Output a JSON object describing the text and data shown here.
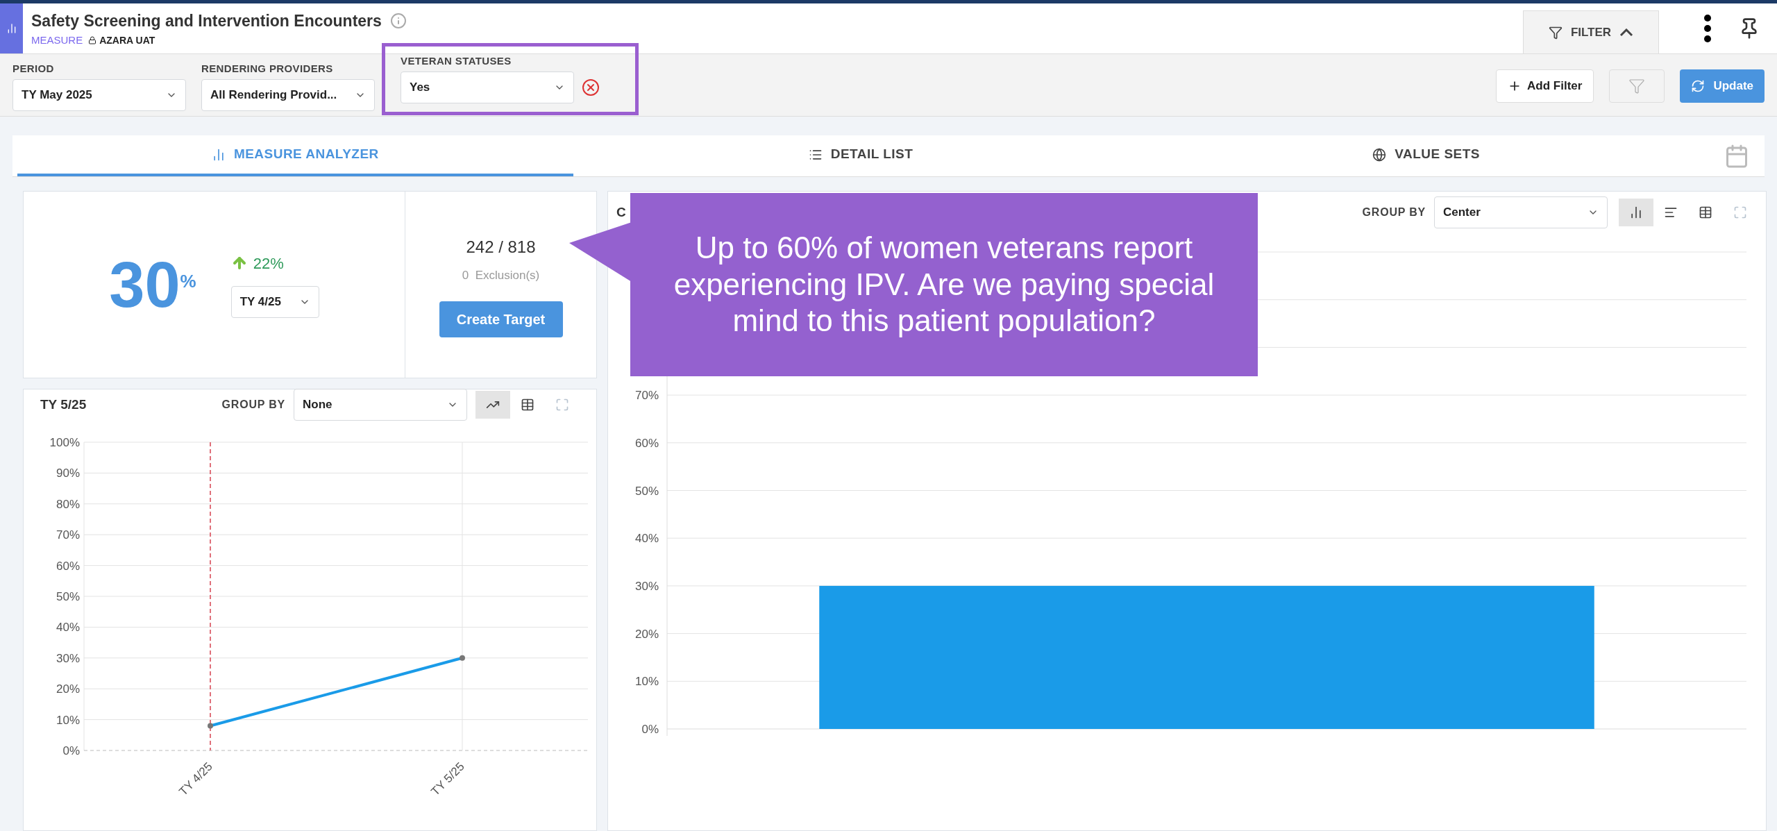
{
  "header": {
    "title": "Safety Screening and Intervention Encounters",
    "type_label": "MEASURE",
    "workspace": "AZARA UAT",
    "filter_toggle": {
      "label": "FILTER",
      "expanded": true
    }
  },
  "filters": [
    {
      "label": "PERIOD",
      "value": "TY May 2025",
      "highlighted": false
    },
    {
      "label": "RENDERING PROVIDERS",
      "value": "All Rendering Provid...",
      "highlighted": false
    },
    {
      "label": "VETERAN STATUSES",
      "value": "Yes",
      "removable": true,
      "highlighted": true
    }
  ],
  "filter_actions": {
    "add_label": "Add Filter",
    "update_label": "Update"
  },
  "tabs": [
    {
      "kind": "analyzer",
      "label": "MEASURE ANALYZER",
      "selected": true
    },
    {
      "kind": "list",
      "label": "DETAIL LIST",
      "selected": false
    },
    {
      "kind": "sets",
      "label": "VALUE SETS",
      "selected": false
    }
  ],
  "summary": {
    "rate": "30",
    "rate_unit": "%",
    "change": "22%",
    "increase": true,
    "compare_period": "TY 4/25",
    "ratio": "242 / 818",
    "exclusions": "0  Exclusion(s)",
    "target_button": "Create Target"
  },
  "trend": {
    "title": "TY 5/25",
    "group_by_label": "GROUP BY",
    "group_by": "None",
    "views": [
      {
        "kind": "line",
        "selected": true
      },
      {
        "kind": "table",
        "selected": false
      },
      {
        "kind": "expand",
        "selected": false
      }
    ],
    "chart_data": {
      "type": "line",
      "grid": true,
      "categories": [
        "TY 4/25",
        "TY 5/25"
      ],
      "series": [
        {
          "color": "#1a9be8",
          "marker": true,
          "values": [
            8,
            30
          ]
        }
      ],
      "ref_lines": [
        {
          "axis": "x",
          "value": "TY 4/25",
          "color": "#e0707a"
        }
      ],
      "ylim": [
        0,
        100
      ],
      "yticks": [
        {
          "value": 0,
          "label": "0%"
        },
        {
          "value": 10,
          "label": "10%"
        },
        {
          "value": 20,
          "label": "20%"
        },
        {
          "value": 30,
          "label": "30%"
        },
        {
          "value": 40,
          "label": "40%"
        },
        {
          "value": 50,
          "label": "50%"
        },
        {
          "value": 60,
          "label": "60%"
        },
        {
          "value": 70,
          "label": "70%"
        },
        {
          "value": 80,
          "label": "80%"
        },
        {
          "value": 90,
          "label": "90%"
        },
        {
          "value": 100,
          "label": "100%"
        }
      ]
    }
  },
  "breakdown": {
    "title": "C",
    "group_by_label": "GROUP BY",
    "group_by": "Center",
    "views": [
      {
        "kind": "bar",
        "selected": true
      },
      {
        "kind": "hbar",
        "selected": false
      },
      {
        "kind": "table",
        "selected": false
      },
      {
        "kind": "expand",
        "selected": false
      }
    ],
    "chart_data": {
      "type": "bar",
      "grid": true,
      "values": [
        30
      ],
      "color": "#1a9be8",
      "ylim": [
        0,
        100
      ],
      "yticks": [
        {
          "value": 0,
          "label": "0%"
        },
        {
          "value": 10,
          "label": "10%"
        },
        {
          "value": 20,
          "label": "20%"
        },
        {
          "value": 30,
          "label": "30%"
        },
        {
          "value": 40,
          "label": "40%"
        },
        {
          "value": 50,
          "label": "50%"
        },
        {
          "value": 60,
          "label": "60%"
        },
        {
          "value": 70,
          "label": "70%"
        }
      ]
    }
  },
  "callout": {
    "text": "Up to 60% of women veterans report experiencing IPV. Are we paying special mind to this patient population?"
  }
}
